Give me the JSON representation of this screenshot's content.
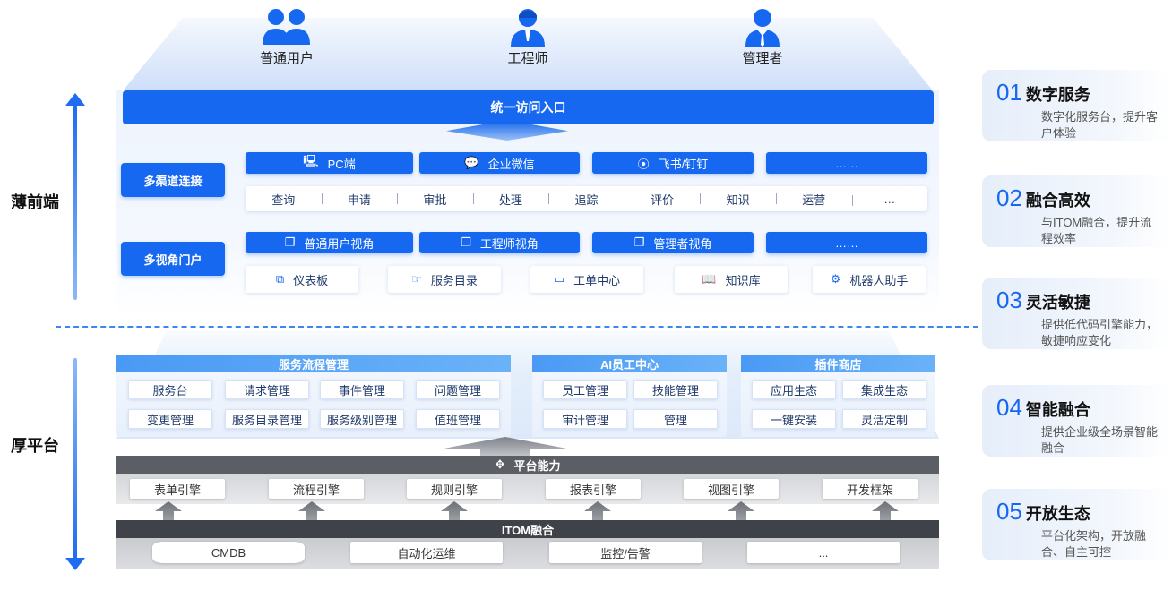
{
  "users": [
    {
      "label": "普通用户",
      "icon": "two-users-icon"
    },
    {
      "label": "工程师",
      "icon": "engineer-icon"
    },
    {
      "label": "管理者",
      "icon": "manager-icon"
    }
  ],
  "side": {
    "front": "薄前端",
    "platform": "厚平台"
  },
  "entry": "统一访问入口",
  "multichannel": {
    "label": "多渠道连接",
    "channels": [
      "PC端",
      "企业微信",
      "飞书/钉钉",
      "……"
    ],
    "actions": [
      "查询",
      "申请",
      "审批",
      "处理",
      "追踪",
      "评价",
      "知识",
      "运营",
      "…"
    ]
  },
  "multiview": {
    "label": "多视角门户",
    "views": [
      "普通用户视角",
      "工程师视角",
      "管理者视角",
      "……"
    ],
    "portals": [
      "仪表板",
      "服务目录",
      "工单中心",
      "知识库",
      "机器人助手"
    ]
  },
  "service_flow": {
    "title": "服务流程管理",
    "items": [
      "服务台",
      "请求管理",
      "事件管理",
      "问题管理",
      "变更管理",
      "服务目录管理",
      "服务级别管理",
      "值班管理"
    ]
  },
  "ai_center": {
    "title": "AI员工中心",
    "items": [
      "员工管理",
      "技能管理",
      "审计管理",
      "管理"
    ]
  },
  "plugin_store": {
    "title": "插件商店",
    "items": [
      "应用生态",
      "集成生态",
      "一键安装",
      "灵活定制"
    ]
  },
  "platform": {
    "title": "平台能力",
    "engines": [
      "表单引擎",
      "流程引擎",
      "规则引擎",
      "报表引擎",
      "视图引擎",
      "开发框架"
    ]
  },
  "itom": {
    "title": "ITOM融合",
    "items": [
      "CMDB",
      "自动化运维",
      "监控/告警",
      "..."
    ]
  },
  "features": [
    {
      "num": "01",
      "name": "数字服务",
      "desc": "数字化服务台，提升客户体验"
    },
    {
      "num": "02",
      "name": "融合高效",
      "desc": "与ITOM融合，提升流程效率"
    },
    {
      "num": "03",
      "name": "灵活敏捷",
      "desc": "提供低代码引擎能力，敏捷响应变化"
    },
    {
      "num": "04",
      "name": "智能融合",
      "desc": "提供企业级全场景智能融合"
    },
    {
      "num": "05",
      "name": "开放生态",
      "desc": "平台化架构，开放融合、自主可控"
    }
  ],
  "colors": {
    "primary": "#1668f0",
    "header_light": "#4a9af5",
    "dark_bar": "#5b5e64",
    "itom_bar": "#3f4248"
  }
}
